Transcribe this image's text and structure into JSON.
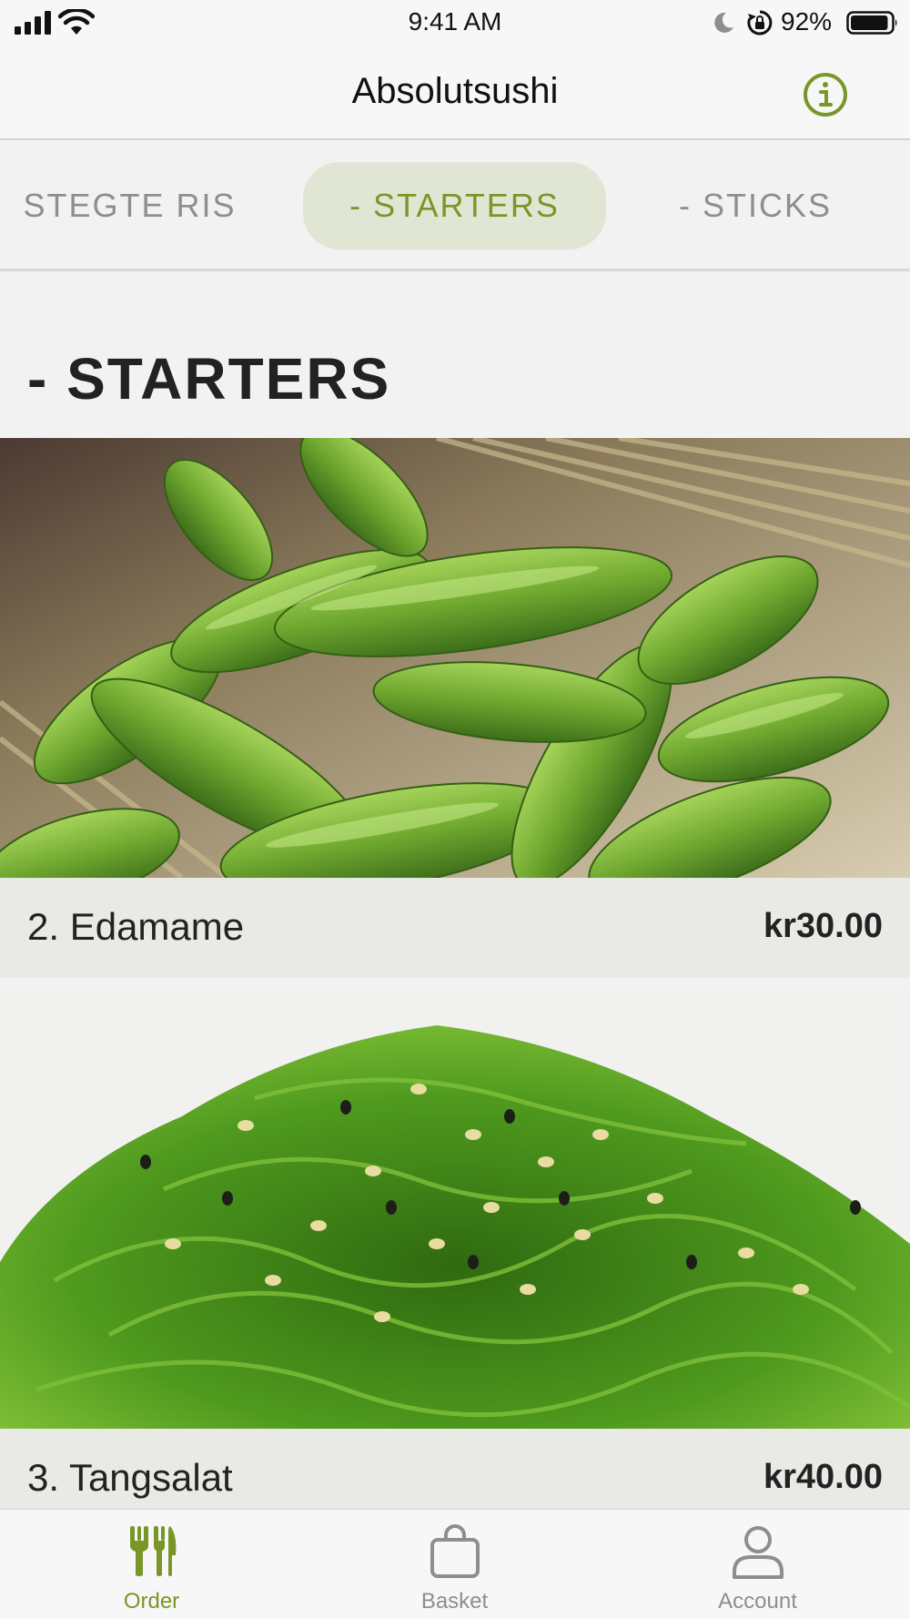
{
  "status_bar": {
    "time": "9:41 AM",
    "battery_percent": "92%",
    "battery_level": 0.92,
    "icons": [
      "cellular-signal-icon",
      "wifi-icon",
      "moon-icon",
      "rotation-lock-icon",
      "battery-icon"
    ]
  },
  "nav": {
    "title": "Absolutsushi",
    "info_icon": "info-icon"
  },
  "categories": {
    "tabs": [
      "STEGTE RIS",
      "- STARTERS",
      "- STICKS"
    ],
    "selected": "- STARTERS"
  },
  "section": {
    "title": "- STARTERS"
  },
  "items": [
    {
      "name": "2. Edamame",
      "price": "kr30.00"
    },
    {
      "name": "3. Tangsalat",
      "price": "kr40.00"
    }
  ],
  "tab_bar": {
    "items": [
      {
        "label": "Order",
        "icon": "fork-knife-icon"
      },
      {
        "label": "Basket",
        "icon": "shopping-bag-icon"
      },
      {
        "label": "Account",
        "icon": "person-icon"
      }
    ],
    "selected": "Order"
  },
  "colors": {
    "accent": "#7a9628",
    "selected_tab_bg": "#e1e6d4",
    "inactive": "#8e8e8e"
  }
}
